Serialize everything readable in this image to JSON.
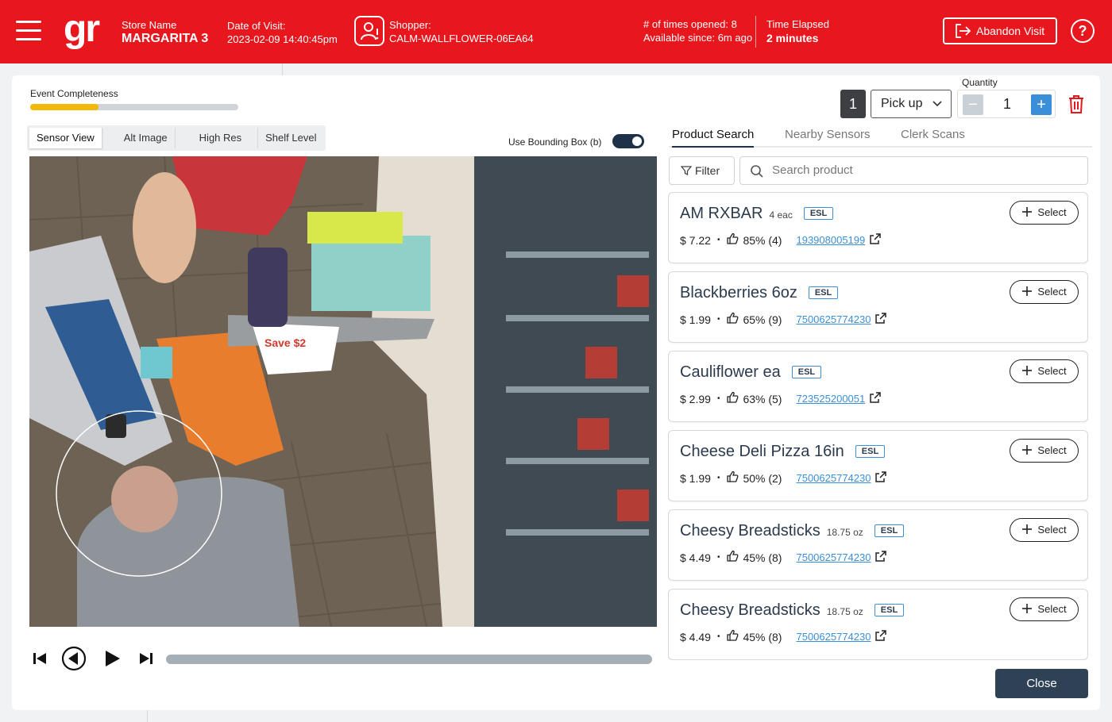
{
  "header": {
    "logo_text": "gr",
    "store_label": "Store Name",
    "store_name": "MARGARITA 3",
    "date_label": "Date of Visit:",
    "date_value": "2023-02-09 14:40:45pm",
    "shopper_label": "Shopper:",
    "shopper_id": "CALM-WALLFLOWER-06EA64",
    "times_opened": "# of times opened: 8",
    "available_since": "Available since: 6m ago",
    "elapsed_label": "Time Elapsed",
    "elapsed_value": "2 minutes",
    "abandon_label": "Abandon Visit",
    "help": "?"
  },
  "event": {
    "completeness_label": "Event Completeness",
    "completeness_fraction": 0.33
  },
  "view_tabs": [
    {
      "label": "Sensor View",
      "active": true
    },
    {
      "label": "Alt Image",
      "active": false
    },
    {
      "label": "High Res",
      "active": false
    },
    {
      "label": "Shelf Level",
      "active": false
    }
  ],
  "bbox": {
    "label": "Use Bounding Box (b)",
    "enabled": true
  },
  "video_promo_text": "Save $2",
  "action": {
    "sequence": "1",
    "type": "Pick up",
    "quantity_label": "Quantity",
    "quantity": "1",
    "minus": "−",
    "plus": "+"
  },
  "search_tabs": [
    {
      "label": "Product Search",
      "active": true
    },
    {
      "label": "Nearby Sensors",
      "active": false
    },
    {
      "label": "Clerk Scans",
      "active": false
    }
  ],
  "filter_label": "Filter",
  "search_placeholder": "Search product",
  "select_label": "Select",
  "esl_label": "ESL",
  "products": [
    {
      "name": "AM RXBAR",
      "size": "4 eac",
      "price": "$ 7.22",
      "pct": "85% (4)",
      "sku": "193908005199"
    },
    {
      "name": "Blackberries 6oz",
      "size": "",
      "price": "$ 1.99",
      "pct": "65% (9)",
      "sku": "7500625774230"
    },
    {
      "name": "Cauliflower ea",
      "size": "",
      "price": "$ 2.99",
      "pct": "63% (5)",
      "sku": "723525200051"
    },
    {
      "name": "Cheese Deli Pizza 16in",
      "size": "",
      "price": "$ 1.99",
      "pct": "50% (2)",
      "sku": "7500625774230"
    },
    {
      "name": "Cheesy Breadsticks",
      "size": "18.75 oz",
      "price": "$ 4.49",
      "pct": "45% (8)",
      "sku": "7500625774230"
    },
    {
      "name": "Cheesy Breadsticks",
      "size": "18.75 oz",
      "price": "$ 4.49",
      "pct": "45% (8)",
      "sku": "7500625774230"
    }
  ],
  "close_label": "Close",
  "colors": {
    "brand_red": "#e8161d",
    "accent_blue": "#3a8fd8",
    "navy": "#1f3149",
    "progress_yellow": "#f2b707"
  }
}
